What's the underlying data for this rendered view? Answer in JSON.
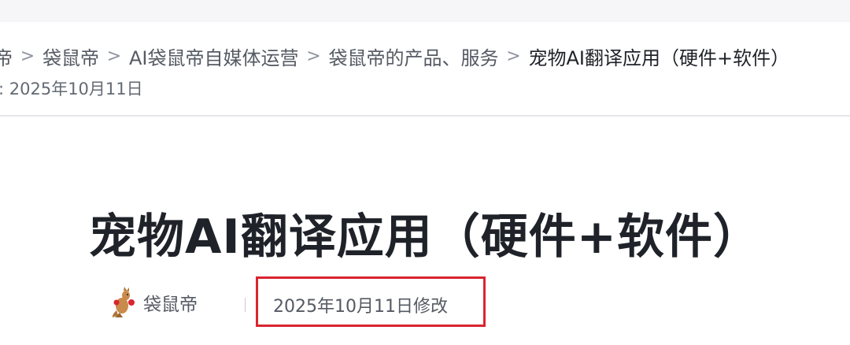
{
  "breadcrumb": {
    "items": [
      "帝",
      "袋鼠帝",
      "AI袋鼠帝自媒体运营",
      "袋鼠帝的产品、服务",
      "宠物AI翻译应用（硬件+软件）"
    ],
    "separator": ">"
  },
  "updated": {
    "text": ": 2025年10月11日"
  },
  "document": {
    "title": "宠物AI翻译应用（硬件+软件）",
    "author": "袋鼠帝",
    "modified": "2025年10月11日修改"
  },
  "colors": {
    "highlight_box": "#d9252f",
    "title": "#1f2329",
    "muted_text": "#555a63"
  },
  "icons": {
    "avatar": "kangaroo-avatar-icon"
  }
}
